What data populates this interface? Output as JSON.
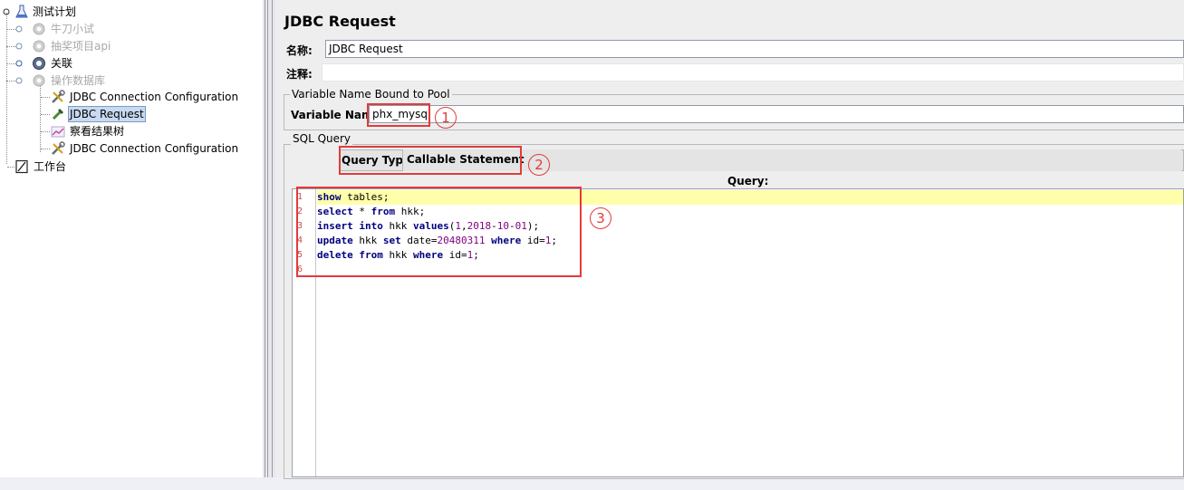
{
  "tree": {
    "items": [
      {
        "label": "测试计划",
        "icon": "test-plan-flask-icon",
        "enabled": true
      },
      {
        "label": "牛刀小试",
        "icon": "thread-group-gear-icon",
        "enabled": false
      },
      {
        "label": "抽奖项目api",
        "icon": "thread-group-gear-icon",
        "enabled": false
      },
      {
        "label": "关联",
        "icon": "thread-group-gear-icon",
        "enabled": true
      },
      {
        "label": "操作数据库",
        "icon": "thread-group-gear-icon",
        "enabled": false
      },
      {
        "label": "JDBC Connection Configuration",
        "icon": "config-wrench-icon",
        "enabled": true
      },
      {
        "label": "JDBC Request",
        "icon": "sampler-pipette-icon",
        "enabled": true,
        "selected": true
      },
      {
        "label": "察看结果树",
        "icon": "listener-graph-icon",
        "enabled": true
      },
      {
        "label": "JDBC Connection Configuration",
        "icon": "config-wrench-icon",
        "enabled": true
      },
      {
        "label": "工作台",
        "icon": "workbench-icon",
        "enabled": true
      }
    ]
  },
  "panel": {
    "title": "JDBC Request",
    "name_label": "名称:",
    "name_value": "JDBC Request",
    "comment_label": "注释:",
    "comment_value": "",
    "pool_group_title": "Variable Name Bound to Pool",
    "variable_name_label": "Variable Name",
    "variable_name_value": "phx_mysql",
    "sql_group_title": "SQL Query",
    "query_type_label": "Query Type:",
    "query_type_value": "Callable Statement",
    "query_label": "Query:",
    "annotations": [
      "1",
      "2",
      "3"
    ],
    "annotation_color": "#e23b3b",
    "code_lines": [
      "show tables;",
      "select * from hkk;",
      "insert into hkk values(1,2018-10-01);",
      "update hkk set date=20480311 where id=1;",
      "delete from hkk where id=1;",
      ""
    ],
    "line_numbers": [
      "1",
      "2",
      "3",
      "4",
      "5",
      "6"
    ]
  }
}
